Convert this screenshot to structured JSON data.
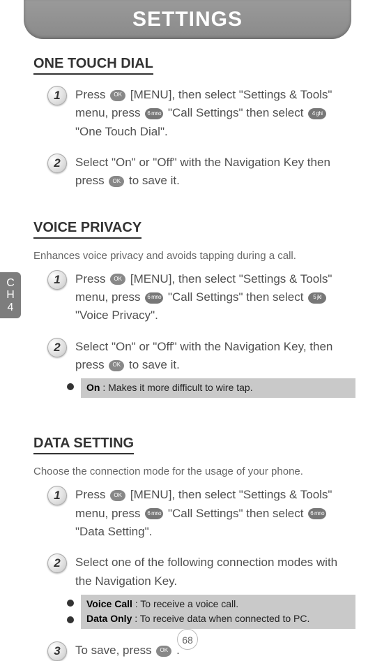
{
  "header": {
    "title": "SETTINGS"
  },
  "sideTab": {
    "line1": "C",
    "line2": "H",
    "line3": "4"
  },
  "keys": {
    "ok": "OK",
    "k4": "4 ghi",
    "k5": "5 jkl",
    "k6": "6 mno"
  },
  "sections": {
    "oneTouch": {
      "title": "ONE TOUCH DIAL",
      "step1": {
        "num": "1",
        "a": "Press ",
        "b": " [MENU], then select \"Settings & Tools\" menu, press ",
        "c": " \"Call Settings\" then select ",
        "d": " \"One Touch Dial\"."
      },
      "step2": {
        "num": "2",
        "a": "Select \"On\" or \"Off\" with the Navigation Key then press ",
        "b": " to save it."
      }
    },
    "voicePrivacy": {
      "title": "VOICE PRIVACY",
      "desc": "Enhances voice privacy and avoids tapping during a call.",
      "step1": {
        "num": "1",
        "a": "Press ",
        "b": " [MENU], then select \"Settings & Tools\" menu, press ",
        "c": " \"Call Settings\" then select ",
        "d": " \"Voice Privacy\"."
      },
      "step2": {
        "num": "2",
        "a": "Select \"On\" or \"Off\" with the Navigation Key, then press ",
        "b": " to save it."
      },
      "note1_bold": "On",
      "note1_rest": " : Makes it more difficult to wire tap."
    },
    "dataSetting": {
      "title": "DATA SETTING",
      "desc": "Choose the connection mode for the usage of your phone.",
      "step1": {
        "num": "1",
        "a": "Press ",
        "b": " [MENU], then select \"Settings & Tools\" menu, press ",
        "c": " \"Call Settings\" then select ",
        "d": " \"Data Setting\"."
      },
      "step2": {
        "num": "2",
        "text": "Select one of the following connection modes with the Navigation Key."
      },
      "note_vc_bold": "Voice Call",
      "note_vc_rest": " : To receive a voice call.",
      "note_do_bold": "Data Only",
      "note_do_rest": " : To receive data when connected to PC.",
      "step3": {
        "num": "3",
        "a": "To save, press ",
        "b": " ."
      }
    }
  },
  "pageNumber": "68"
}
